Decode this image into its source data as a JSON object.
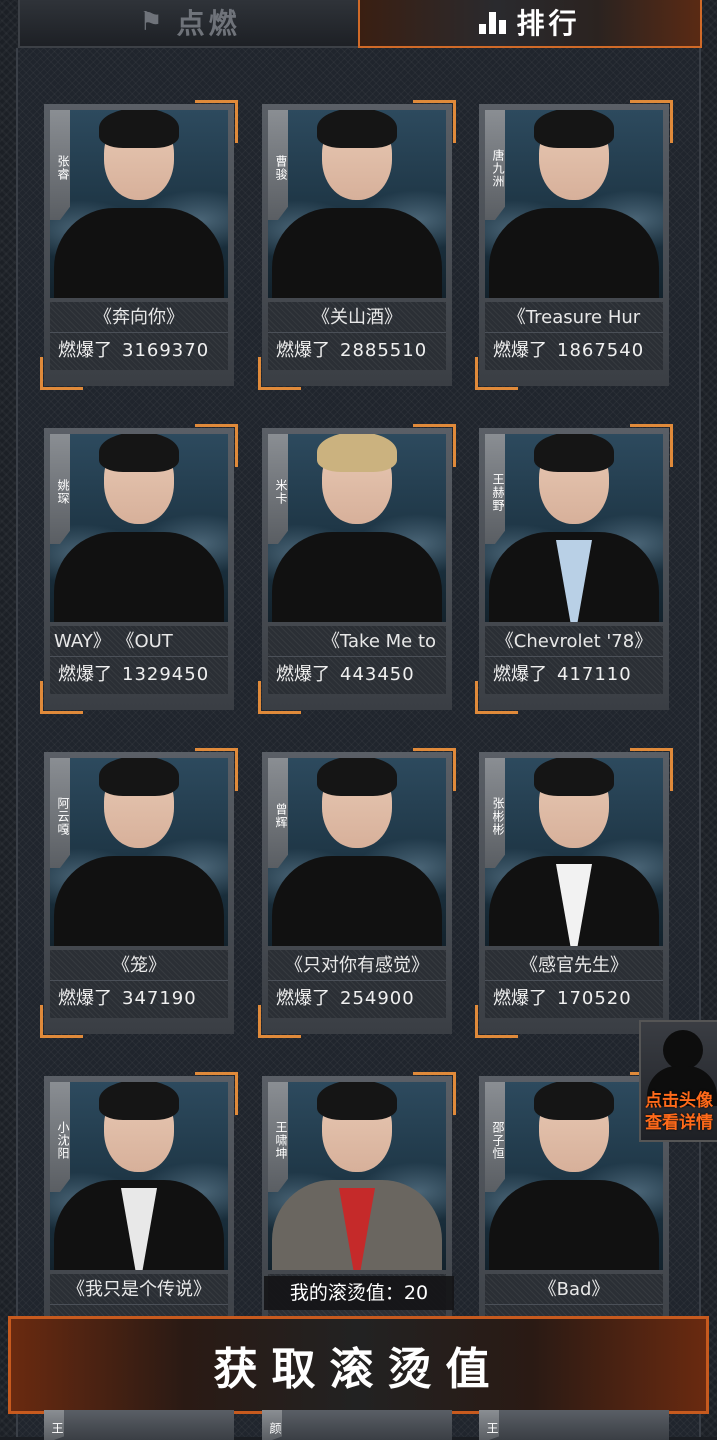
{
  "tabs": {
    "ignite": {
      "label": "点燃"
    },
    "rank": {
      "label": "排行"
    }
  },
  "score_label": "燃爆了",
  "cards": [
    {
      "name": "张睿",
      "song": "《奔向你》",
      "score": "3169370"
    },
    {
      "name": "曹骏",
      "song": "《关山酒》",
      "score": "2885510"
    },
    {
      "name": "唐九洲",
      "song": "《Treasure Hur",
      "score": "1867540"
    },
    {
      "name": "姚琛",
      "song": "WAY》        《OUT",
      "score": "1329450"
    },
    {
      "name": "米卡",
      "song": "《Take Me to",
      "score": "443450"
    },
    {
      "name": "王赫野",
      "song": "《Chevrolet '78》",
      "score": "417110"
    },
    {
      "name": "阿云嘎",
      "song": "《笼》",
      "score": "347190"
    },
    {
      "name": "曾辉",
      "song": "《只对你有感觉》",
      "score": "254900"
    },
    {
      "name": "张彬彬",
      "song": "《感官先生》",
      "score": "170520"
    },
    {
      "name": "小沈阳",
      "song": "《我只是个传说》",
      "score": ""
    },
    {
      "name": "王啸坤",
      "song": "",
      "score": ""
    },
    {
      "name": "邵子恒",
      "song": "《Bad》",
      "score": ""
    }
  ],
  "next_row_names": [
    "王",
    "颜",
    "王"
  ],
  "side_button": {
    "line1": "点击头像",
    "line2": "查看详情"
  },
  "my_value": {
    "label": "我的滚烫值：",
    "value": "20"
  },
  "cta": {
    "label": "获取滚烫值"
  }
}
